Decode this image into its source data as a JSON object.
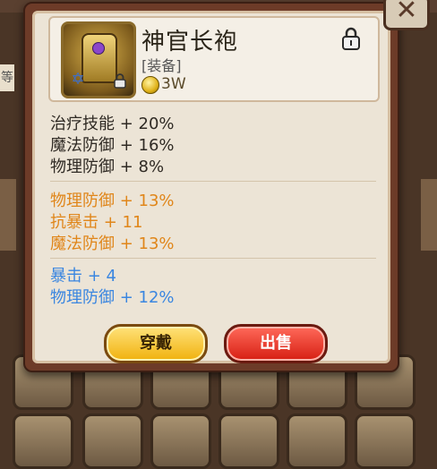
{
  "background": {
    "side_label": "等"
  },
  "dialog": {
    "close_symbol": "✕"
  },
  "item": {
    "name": "神官长袍",
    "type": "[装备]",
    "price": "3W",
    "badge_symbol": "✡"
  },
  "base_stats": [
    "治疗技能 + 20%",
    "魔法防御 + 16%",
    "物理防御 + 8%"
  ],
  "orange_stats": [
    "物理防御 + 13%",
    "抗暴击 + 11",
    "魔法防御 + 13%"
  ],
  "blue_stats": [
    "暴击 + 4",
    "物理防御 + 12%"
  ],
  "buttons": {
    "equip": "穿戴",
    "sell": "出售"
  },
  "colors": {
    "orange_stat": "#e0861a",
    "blue_stat": "#3a86e0",
    "equip_button": "#f0b10d",
    "sell_button": "#d61e12"
  }
}
